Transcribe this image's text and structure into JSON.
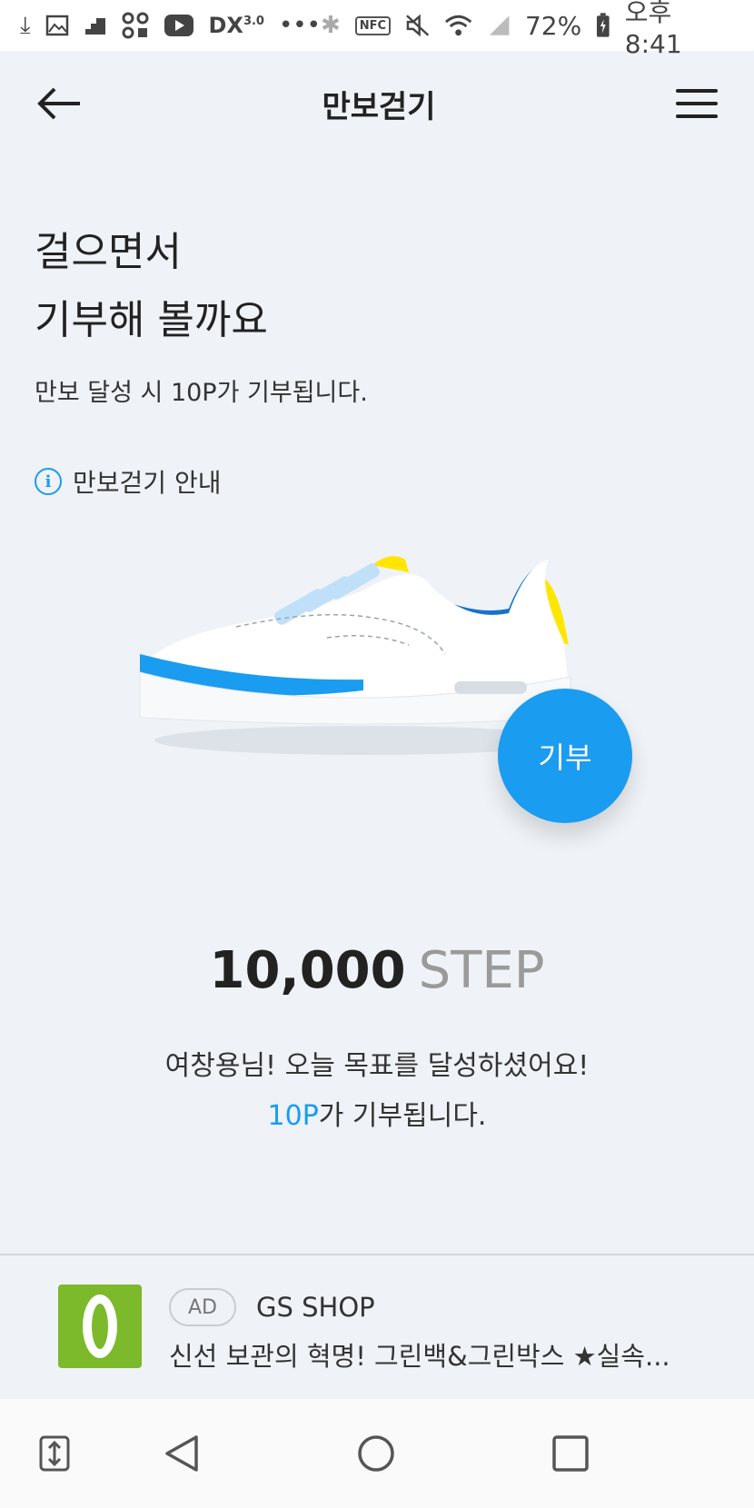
{
  "status_bar": {
    "left_icons": [
      "download-icon",
      "image-icon",
      "stairs-icon",
      "qr-icon",
      "youtube-icon",
      "dx-icon",
      "more-dots-icon"
    ],
    "dx_label": "DX",
    "dx_sup": "3.0",
    "right_icons": [
      "bluetooth-icon",
      "nfc-icon",
      "mute-icon",
      "wifi-icon",
      "signal-icon",
      "battery-icon"
    ],
    "nfc_label": "NFC",
    "battery": "72%",
    "time": "오후 8:41"
  },
  "header": {
    "title": "만보걷기"
  },
  "intro": {
    "line1": "걸으면서",
    "line2": "기부해 볼까요",
    "subtext": "만보 달성 시 10P가 기부됩니다.",
    "info_icon_glyph": "i",
    "info_link": "만보걷기 안내"
  },
  "donate_button": "기부",
  "steps": {
    "count": "10,000",
    "unit": "STEP"
  },
  "message": {
    "line1": "여창용님! 오늘 목표를 달성하셨어요!",
    "points": "10P",
    "line2_rest": "가 기부됩니다."
  },
  "ad": {
    "badge": "AD",
    "advertiser": "GS SHOP",
    "description": "신선 보관의 혁명! 그린백&그린박스 ★실속..."
  },
  "colors": {
    "accent": "#1a9cf0",
    "background": "#eff2f6",
    "shoe_yellow": "#ffe600",
    "ad_logo_green": "#7cb92b"
  },
  "navbar": {
    "icons": [
      "swap-icon",
      "back-triangle-icon",
      "home-circle-icon",
      "recents-square-icon"
    ]
  }
}
